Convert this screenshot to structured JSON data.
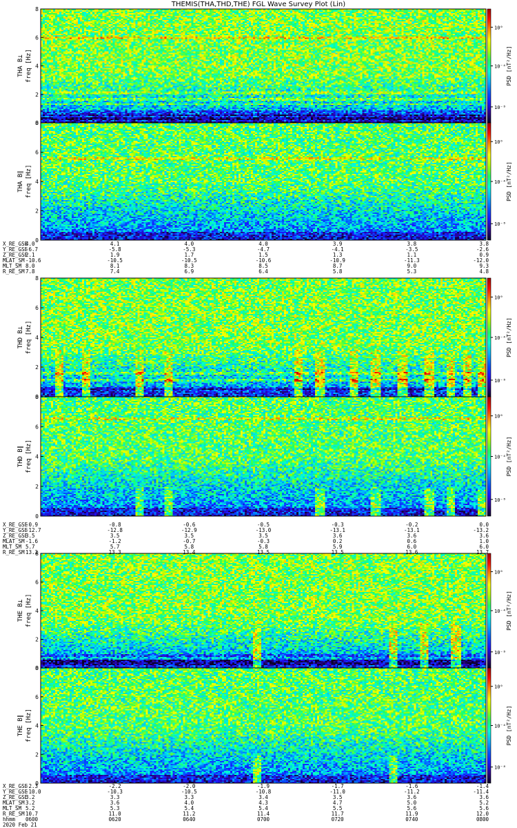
{
  "title": "THEMIS(THA,THD,THE) FGL Wave Survey Plot (Lin)",
  "chart_data": {
    "type": "heatmap",
    "x_ticks": [
      "0600",
      "0620",
      "0640",
      "0700",
      "0720",
      "0740",
      "0800"
    ],
    "date_label": "2020 Feb 21",
    "hhmm_label": "hhmm",
    "freq_ticks": [
      "0",
      "2",
      "4",
      "6",
      "8"
    ],
    "freq_range": [
      0,
      8
    ],
    "cbar_ticks": [
      "10⁰",
      "10⁻⁴",
      "10⁻⁸"
    ],
    "cbar_ticks_bpar": [
      "10⁰",
      "10⁻⁴",
      "10⁻⁸"
    ],
    "cbar_label": "PSD [nT²/Hz]",
    "colors": {
      "background": "#ffffff",
      "colormap": [
        "#0a0028",
        "#2a0090",
        "#1c14ff",
        "#005cff",
        "#00b4ff",
        "#00ffd8",
        "#20ff60",
        "#b4ff00",
        "#ffff00",
        "#ff9000",
        "#ff1000",
        "#a00000"
      ]
    },
    "panels": [
      {
        "probe": "THA",
        "spectra": [
          {
            "name": "THA B⊥",
            "component": "perp",
            "ylabel": "freq [Hz]",
            "bands": [
              0.1,
              0.3,
              0.6,
              0.85,
              1.35,
              1.65,
              2.2,
              6.0
            ],
            "bursts": []
          },
          {
            "name": "THA B∥",
            "component": "par",
            "ylabel": "freq [Hz]",
            "bands": [
              5.6
            ],
            "bursts": []
          }
        ],
        "ephemeris": [
          {
            "label": "X_RE_GSE",
            "values": [
              "4.0",
              "4.1",
              "4.0",
              "4.0",
              "3.9",
              "3.8",
              "3.8"
            ]
          },
          {
            "label": "Y_RE_GSE",
            "values": [
              "-6.7",
              "-5.8",
              "-5.3",
              "-4.7",
              "-4.1",
              "-3.5",
              "-2.6"
            ]
          },
          {
            "label": "Z_RE_GSE",
            "values": [
              "2.1",
              "1.9",
              "1.7",
              "1.5",
              "1.3",
              "1.1",
              "0.9"
            ]
          },
          {
            "label": "MLAT_SM",
            "values": [
              "-10.6",
              "-10.5",
              "-10.5",
              "-10.6",
              "-10.9",
              "-11.3",
              "-12.0"
            ]
          },
          {
            "label": "MLT_SM",
            "values": [
              "8.0",
              "8.1",
              "8.3",
              "8.5",
              "8.7",
              "9.0",
              "9.3"
            ]
          },
          {
            "label": "R_RE_SM",
            "values": [
              "7.8",
              "7.4",
              "6.9",
              "6.4",
              "5.8",
              "5.3",
              "4.8"
            ]
          }
        ]
      },
      {
        "probe": "THD",
        "spectra": [
          {
            "name": "THD B⊥",
            "component": "perp",
            "ylabel": "freq [Hz]",
            "bands": [
              0.6,
              1.2,
              1.6
            ],
            "bursts": [
              0.04,
              0.1,
              0.22,
              0.285,
              0.575,
              0.625,
              0.7,
              0.75,
              0.81,
              0.87,
              0.92,
              0.955,
              0.99
            ]
          },
          {
            "name": "THD B∥",
            "component": "par",
            "ylabel": "freq [Hz]",
            "bands": [
              6.6
            ],
            "bursts": [
              0.22,
              0.285,
              0.625,
              0.75,
              0.87,
              0.92,
              0.99
            ]
          }
        ],
        "ephemeris": [
          {
            "label": "X_RE_GSE",
            "values": [
              "-0.9",
              "-0.8",
              "-0.6",
              "-0.5",
              "-0.3",
              "-0.2",
              "0.0"
            ]
          },
          {
            "label": "Y_RE_GSE",
            "values": [
              "-12.7",
              "-12.8",
              "-12.9",
              "-13.0",
              "-13.1",
              "-13.1",
              "-13.2"
            ]
          },
          {
            "label": "Z_RE_GSE",
            "values": [
              "3.5",
              "3.5",
              "3.5",
              "3.5",
              "3.6",
              "3.6",
              "3.6"
            ]
          },
          {
            "label": "MLAT_SM",
            "values": [
              "-1.6",
              "-1.2",
              "-0.7",
              "-0.3",
              "0.2",
              "0.6",
              "1.0"
            ]
          },
          {
            "label": "MLT_SM",
            "values": [
              "5.7",
              "5.7",
              "5.8",
              "5.8",
              "5.9",
              "6.0",
              "6.0"
            ]
          },
          {
            "label": "R_RE_SM",
            "values": [
              "13.2",
              "13.3",
              "13.4",
              "13.5",
              "13.5",
              "13.6",
              "13.7"
            ]
          }
        ]
      },
      {
        "probe": "THE",
        "spectra": [
          {
            "name": "THE B⊥",
            "component": "perp",
            "ylabel": "freq [Hz]",
            "bands": [
              0.3,
              0.55,
              0.9
            ],
            "bursts": [
              0.485,
              0.79,
              0.86,
              0.93
            ]
          },
          {
            "name": "THE B∥",
            "component": "par",
            "ylabel": "freq [Hz]",
            "bands": [],
            "bursts": [
              0.485,
              0.79
            ]
          }
        ],
        "ephemeris": [
          {
            "label": "X_RE_GSE",
            "values": [
              "-2.3",
              "-2.2",
              "-2.0",
              "-1.9",
              "-1.7",
              "-1.6",
              "-1.4"
            ]
          },
          {
            "label": "Y_RE_GSE",
            "values": [
              "-10.0",
              "-10.3",
              "-10.5",
              "-10.8",
              "-11.0",
              "-11.2",
              "-11.4"
            ]
          },
          {
            "label": "Z_RE_GSE",
            "values": [
              "3.2",
              "3.3",
              "3.3",
              "3.4",
              "3.5",
              "3.6",
              "3.6"
            ]
          },
          {
            "label": "MLAT_SM",
            "values": [
              "3.2",
              "3.6",
              "4.0",
              "4.3",
              "4.7",
              "5.0",
              "5.2"
            ]
          },
          {
            "label": "MLT_SM",
            "values": [
              "5.2",
              "5.3",
              "5.4",
              "5.4",
              "5.5",
              "5.6",
              "5.6"
            ]
          },
          {
            "label": "R_RE_SM",
            "values": [
              "10.7",
              "11.0",
              "11.2",
              "11.4",
              "11.7",
              "11.9",
              "12.0"
            ]
          }
        ]
      }
    ]
  }
}
